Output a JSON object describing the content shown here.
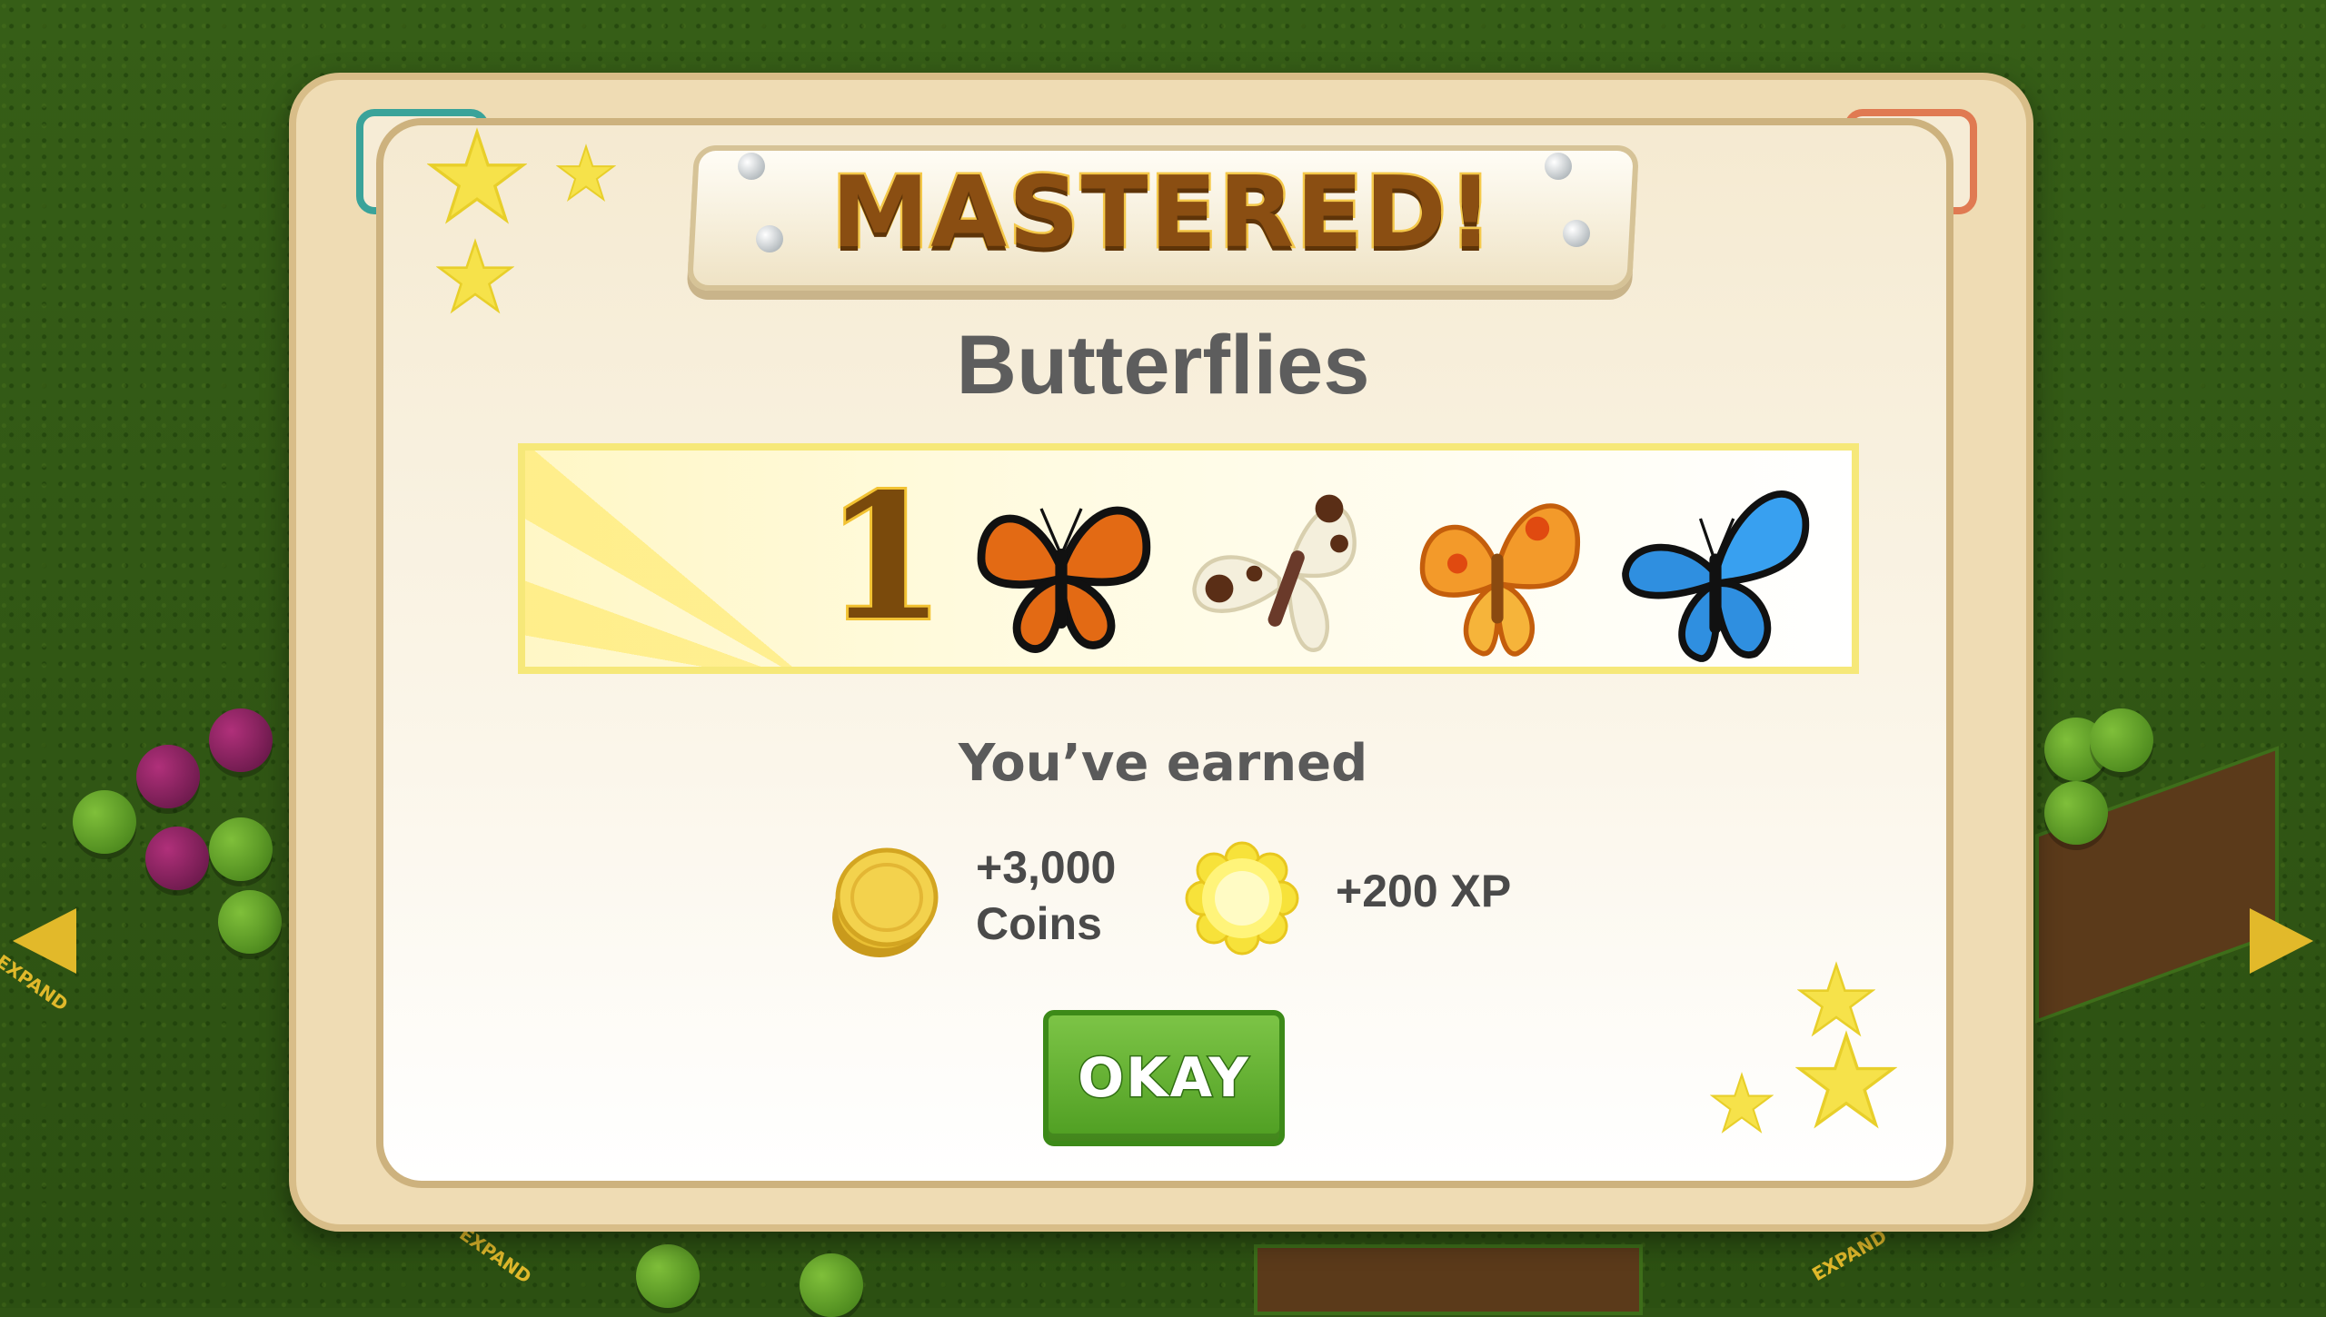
{
  "banner": {
    "text": "MASTERED!"
  },
  "mastery": {
    "collection_name": "Butterflies",
    "rank": "1",
    "items": [
      {
        "icon": "monarch-butterfly-icon",
        "color": "#e36a14"
      },
      {
        "icon": "white-spotted-butterfly-icon",
        "color": "#f4efdc"
      },
      {
        "icon": "orange-fiery-butterfly-icon",
        "color": "#f39a2a"
      },
      {
        "icon": "blue-morpho-butterfly-icon",
        "color": "#2f8fe0"
      }
    ]
  },
  "rewards": {
    "heading": "You’ve earned",
    "coins_amount": "+3,000",
    "coins_label": "Coins",
    "xp": "+200 XP"
  },
  "buttons": {
    "okay": "OKAY"
  },
  "background": {
    "expand_label": "EXPAND"
  },
  "colors": {
    "accent_green": "#5aa82a",
    "star_yellow": "#f6e24a",
    "banner_brown": "#8a4e12"
  }
}
